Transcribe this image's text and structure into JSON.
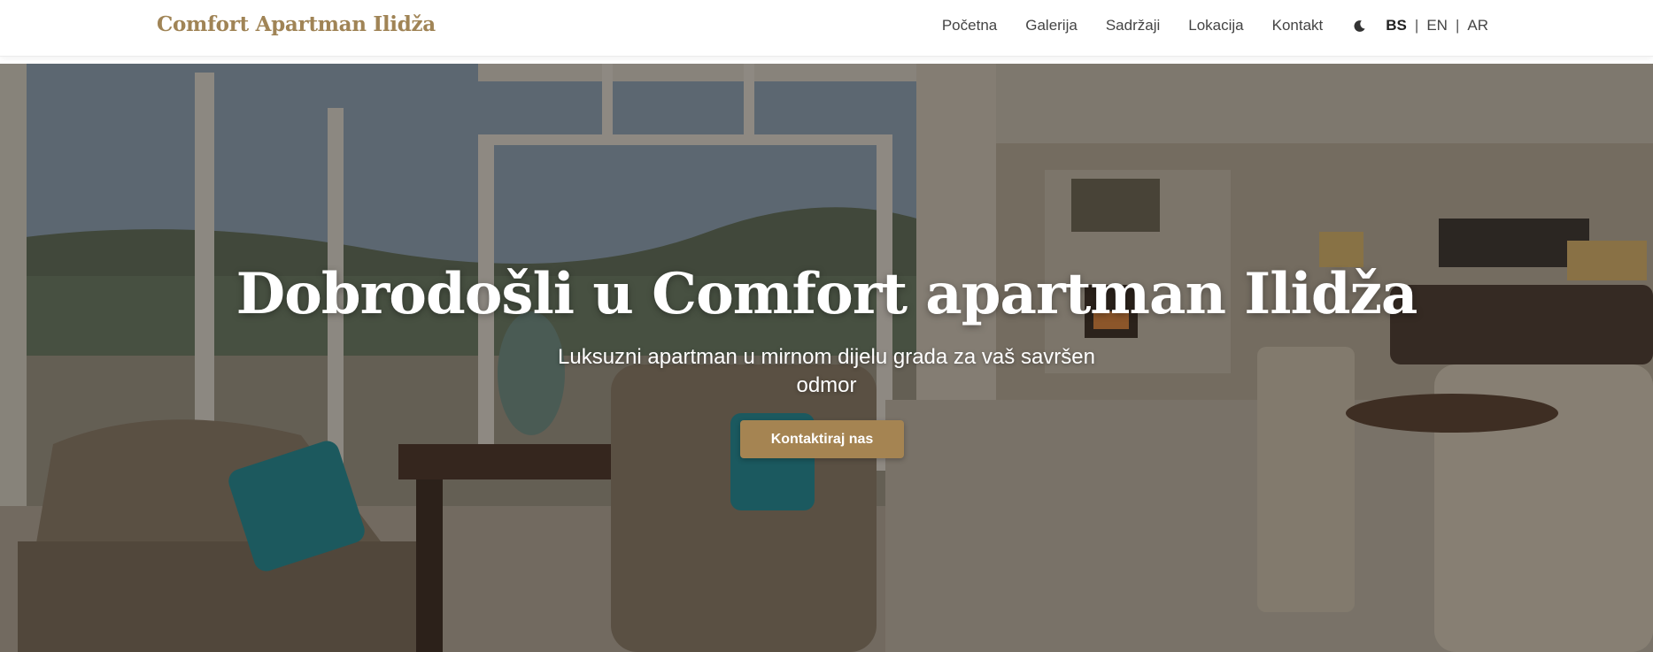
{
  "brand": {
    "name": "Comfort Apartman Ilidža"
  },
  "nav": {
    "links": [
      "Početna",
      "Galerija",
      "Sadržaji",
      "Lokacija",
      "Kontakt"
    ],
    "theme_icon": "moon-icon",
    "languages": [
      "BS",
      "EN",
      "AR"
    ],
    "active_language": "BS",
    "separator": "|"
  },
  "hero": {
    "title": "Dobrodošli u Comfort apartman Ilidža",
    "subtitle": "Luksuzni apartman u mirnom dijelu grada za vaš savršen odmor",
    "cta_label": "Kontaktiraj nas"
  },
  "colors": {
    "accent": "#a58452",
    "brand_text": "#a08456",
    "nav_text": "#444444"
  }
}
